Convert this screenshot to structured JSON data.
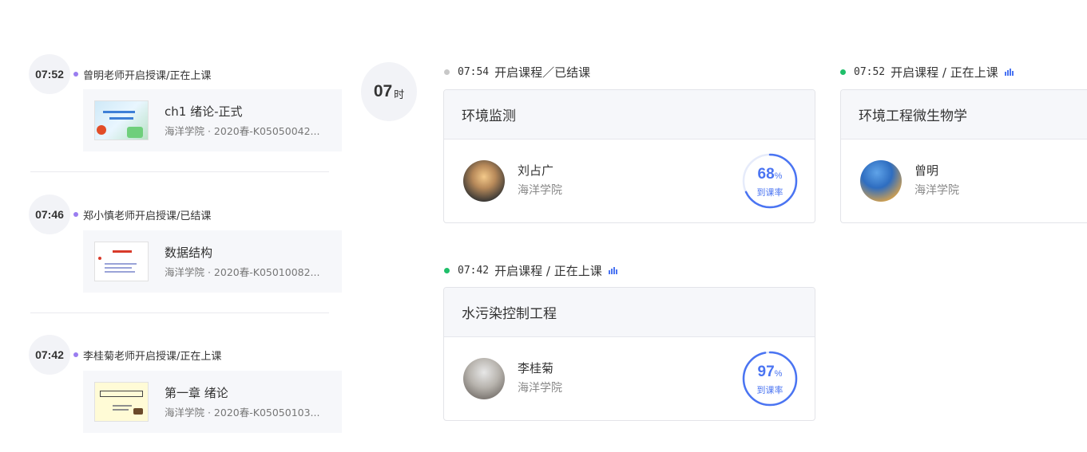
{
  "feed": [
    {
      "time": "07:52",
      "title": "曾明老师开启授课/正在上课",
      "course_name": "ch1 绪论-正式",
      "course_meta": "海洋学院 · 2020春-K05050042..."
    },
    {
      "time": "07:46",
      "title": "郑小慎老师开启授课/已结课",
      "course_name": "数据结构",
      "course_meta": "海洋学院 · 2020春-K05010082..."
    },
    {
      "time": "07:42",
      "title": "李桂菊老师开启授课/正在上课",
      "course_name": "第一章 绪论",
      "course_meta": "海洋学院 · 2020春-K05050103..."
    }
  ],
  "hour": {
    "value": "07",
    "unit": "时"
  },
  "live_courses": [
    {
      "time": "07:54",
      "status": "开启课程／已结课",
      "dot_color": "#c8c8c8",
      "live": false,
      "course": "环境监测",
      "teacher": "刘占广",
      "school": "海洋学院",
      "attendance_value": "68",
      "attendance_fraction": 0.68,
      "attendance_unit": "%",
      "attendance_label": "到课率"
    },
    {
      "time": "07:52",
      "status": "开启课程 / 正在上课",
      "dot_color": "#1fbf6a",
      "live": true,
      "course": "环境工程微生物学",
      "teacher": "曾明",
      "school": "海洋学院"
    },
    {
      "time": "07:42",
      "status": "开启课程 / 正在上课",
      "dot_color": "#1fbf6a",
      "live": true,
      "course": "水污染控制工程",
      "teacher": "李桂菊",
      "school": "海洋学院",
      "attendance_value": "97",
      "attendance_fraction": 0.97,
      "attendance_unit": "%",
      "attendance_label": "到课率"
    }
  ],
  "colors": {
    "accent": "#4a74f2",
    "feed_dot": "#9a7df0",
    "live_dot": "#1fbf6a",
    "ended_dot": "#c8c8c8"
  }
}
